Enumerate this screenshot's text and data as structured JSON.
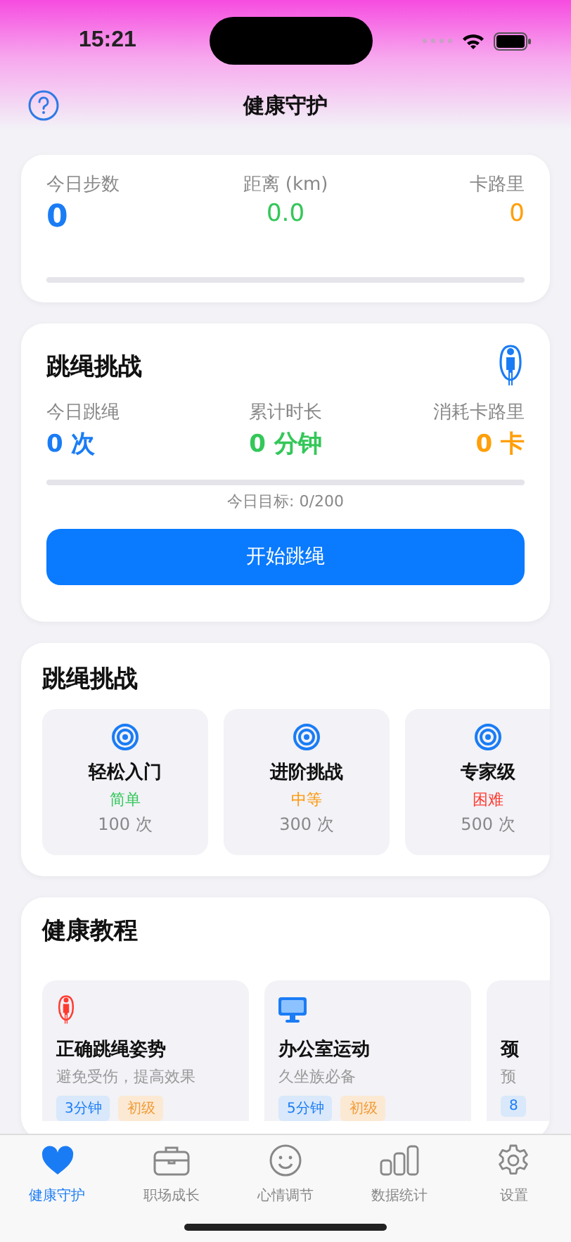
{
  "status_bar": {
    "time": "15:21"
  },
  "header": {
    "title": "健康守护"
  },
  "step_stats": {
    "items": [
      {
        "label": "今日步数",
        "value": "0",
        "color": "#1a7cf5"
      },
      {
        "label": "距离 (km)",
        "value": "0.0",
        "color": "#34c759"
      },
      {
        "label": "卡路里",
        "value": "0",
        "color": "#ff9f0a"
      }
    ],
    "progress": {
      "level": 0
    }
  },
  "jump_card": {
    "title": "跳绳挑战",
    "stats": [
      {
        "label": "今日跳绳",
        "value": "0 次",
        "color": "#1a7cf5"
      },
      {
        "label": "累计时长",
        "value": "0 分钟",
        "color": "#34c759"
      },
      {
        "label": "消耗卡路里",
        "value": "0 卡",
        "color": "#ff9f0a"
      }
    ],
    "progress": {
      "level": 0
    },
    "goal": "今日目标: 0/200",
    "button": "开始跳绳"
  },
  "challenges": {
    "title": "跳绳挑战",
    "items": [
      {
        "name": "轻松入门",
        "difficulty": "简单",
        "color": "#34c759",
        "count": "100 次"
      },
      {
        "name": "进阶挑战",
        "difficulty": "中等",
        "color": "#ff9500",
        "count": "300 次"
      },
      {
        "name": "专家级",
        "difficulty": "困难",
        "color": "#ff3b30",
        "count": "500 次"
      }
    ]
  },
  "tutorials": {
    "title": "健康教程",
    "items": [
      {
        "name": "正确跳绳姿势",
        "desc": "避免受伤，提高效果",
        "tags": [
          "3分钟",
          "初级"
        ]
      },
      {
        "name": "办公室运动",
        "desc": "久坐族必备",
        "tags": [
          "5分钟",
          "初级"
        ]
      },
      {
        "name": "颈",
        "desc": "预",
        "tags": [
          "8"
        ]
      }
    ]
  },
  "tab_bar": {
    "items": [
      {
        "label": "健康守护",
        "selected": true
      },
      {
        "label": "职场成长",
        "selected": false
      },
      {
        "label": "心情调节",
        "selected": false
      },
      {
        "label": "数据统计",
        "selected": false
      },
      {
        "label": "设置",
        "selected": false
      }
    ]
  }
}
